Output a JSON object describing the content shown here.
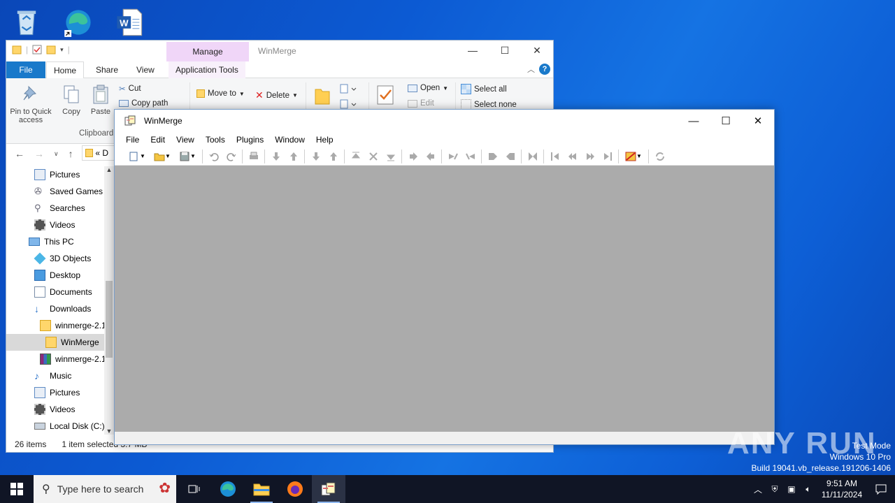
{
  "desktop": {
    "icons": [
      "recycle-bin",
      "microsoft-edge",
      "word-document"
    ]
  },
  "explorer": {
    "window_title": "WinMerge",
    "contextual_group": "Manage",
    "tabs": {
      "file": "File",
      "home": "Home",
      "share": "Share",
      "view": "View",
      "app_tools": "Application Tools"
    },
    "ribbon": {
      "pin": "Pin to Quick access",
      "copy": "Copy",
      "paste": "Paste",
      "cut": "Cut",
      "copy_path": "Copy path",
      "clipboard_group": "Clipboard",
      "move_to": "Move to",
      "delete": "Delete",
      "open": "Open",
      "edit": "Edit",
      "select_all": "Select all",
      "select_none": "Select none"
    },
    "address_prefix": "«",
    "address_text": "D",
    "nav_items": [
      {
        "label": "Pictures",
        "icon": "pictures-icon"
      },
      {
        "label": "Saved Games",
        "icon": "saved-games-icon"
      },
      {
        "label": "Searches",
        "icon": "searches-icon"
      },
      {
        "label": "Videos",
        "icon": "videos-icon"
      },
      {
        "label": "This PC",
        "icon": "this-pc-icon"
      },
      {
        "label": "3D Objects",
        "icon": "3d-objects-icon"
      },
      {
        "label": "Desktop",
        "icon": "desktop-folder-icon"
      },
      {
        "label": "Documents",
        "icon": "documents-icon"
      },
      {
        "label": "Downloads",
        "icon": "downloads-icon"
      },
      {
        "label": "winmerge-2.1",
        "icon": "folder-icon"
      },
      {
        "label": "WinMerge",
        "icon": "folder-icon"
      },
      {
        "label": "winmerge-2.1",
        "icon": "archive-icon"
      },
      {
        "label": "Music",
        "icon": "music-icon"
      },
      {
        "label": "Pictures",
        "icon": "pictures-icon"
      },
      {
        "label": "Videos",
        "icon": "videos-icon"
      },
      {
        "label": "Local Disk (C:)",
        "icon": "local-disk-icon"
      }
    ],
    "status": {
      "items": "26 items",
      "selected": "1 item selected",
      "size": "3.7 MB"
    }
  },
  "winmerge": {
    "title": "WinMerge",
    "menu": [
      "File",
      "Edit",
      "View",
      "Tools",
      "Plugins",
      "Window",
      "Help"
    ]
  },
  "watermark": {
    "logo_text": "ANY RUN",
    "line1": "Test Mode",
    "line2": "Windows 10 Pro",
    "line3": "Build 19041.vb_release.191206-1406"
  },
  "taskbar": {
    "search_placeholder": "Type here to search",
    "time": "9:51 AM",
    "date": "11/11/2024"
  }
}
